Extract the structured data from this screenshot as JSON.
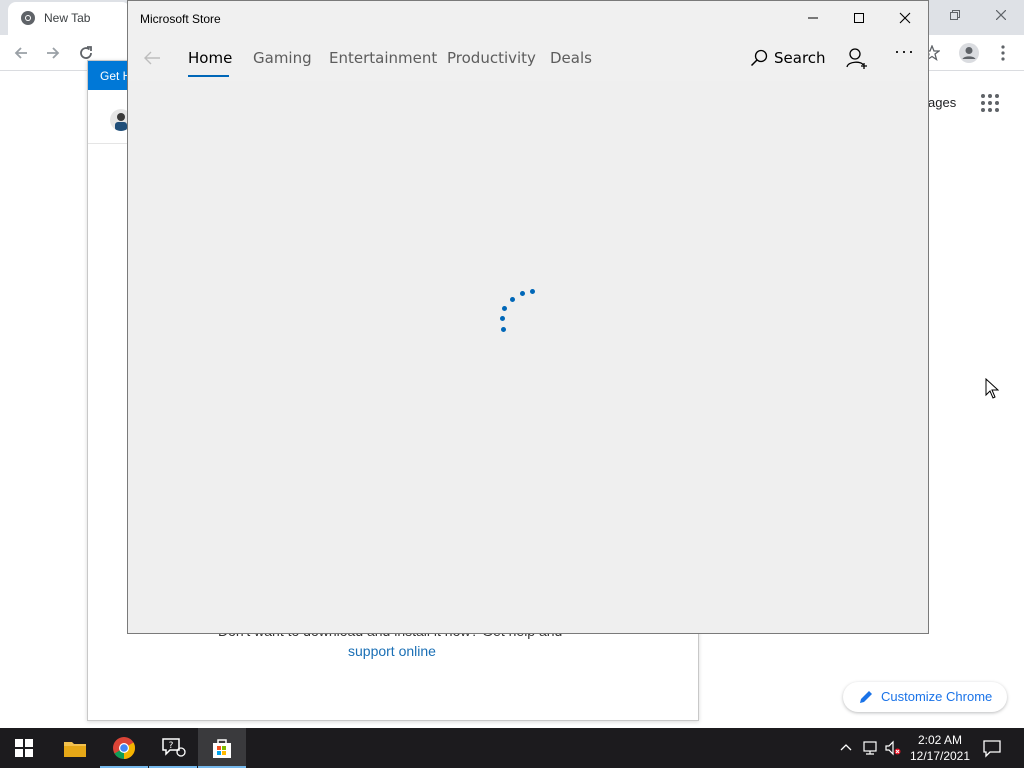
{
  "chrome": {
    "tab_title": "New Tab",
    "images_link": "ages",
    "customize_label": "Customize Chrome"
  },
  "help_panel": {
    "header_text": "Get H",
    "body_text": "Don't want to download and install it now? Get help and",
    "link_text": "support online"
  },
  "store": {
    "title": "Microsoft Store",
    "nav": {
      "tabs": [
        {
          "label": "Home"
        },
        {
          "label": "Gaming"
        },
        {
          "label": "Entertainment"
        },
        {
          "label": "Productivity"
        },
        {
          "label": "Deals"
        }
      ],
      "search_label": "Search",
      "more_label": "···"
    },
    "accent_color": "#0067b8"
  },
  "taskbar": {
    "time": "2:02 AM",
    "date": "12/17/2021",
    "pinned": [
      "start-icon",
      "file-explorer-icon",
      "chrome-icon",
      "get-help-icon",
      "microsoft-store-icon"
    ]
  }
}
